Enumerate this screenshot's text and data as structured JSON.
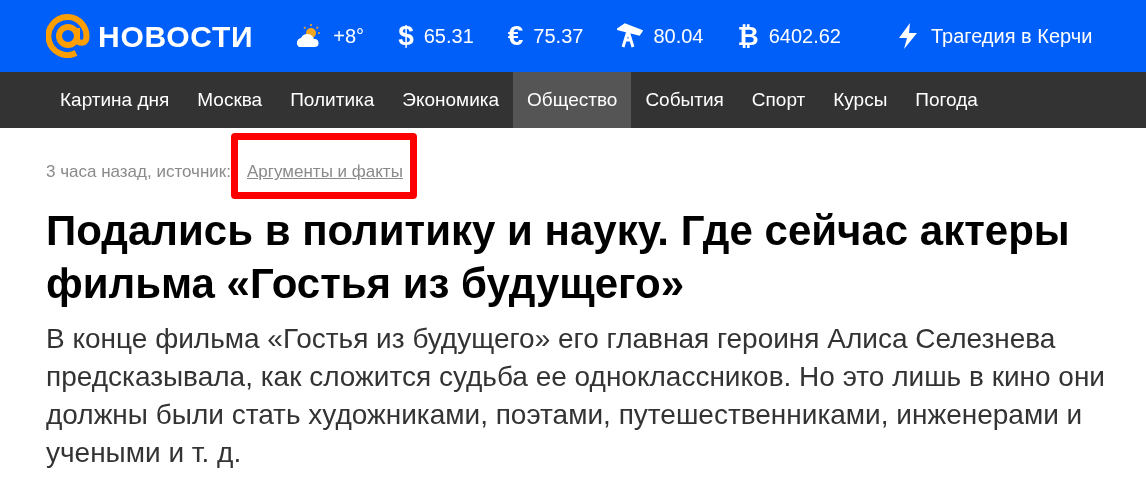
{
  "header": {
    "logo": "НОВОСТИ",
    "tickers": [
      {
        "kind": "weather",
        "value": "+8°"
      },
      {
        "kind": "dollar",
        "symbol": "$",
        "value": "65.31"
      },
      {
        "kind": "euro",
        "symbol": "€",
        "value": "75.37"
      },
      {
        "kind": "oil",
        "value": "80.04"
      },
      {
        "kind": "bitcoin",
        "symbol": "₿",
        "value": "6402.62"
      }
    ],
    "breaking": "Трагедия в Керчи"
  },
  "nav": [
    {
      "label": "Картина дня",
      "selected": false
    },
    {
      "label": "Москва",
      "selected": false
    },
    {
      "label": "Политика",
      "selected": false
    },
    {
      "label": "Экономика",
      "selected": false
    },
    {
      "label": "Общество",
      "selected": true
    },
    {
      "label": "События",
      "selected": false
    },
    {
      "label": "Спорт",
      "selected": false
    },
    {
      "label": "Курсы",
      "selected": false
    },
    {
      "label": "Погода",
      "selected": false
    }
  ],
  "article": {
    "meta": "3 часа назад, источник:",
    "source": "Аргументы и факты",
    "highlight": true,
    "title": "Подались в политику и науку. Где сейчас актеры фильма «Гостья из будущего»",
    "lead": "В конце фильма «Гостья из будущего» его главная героиня Алиса Селезнева предсказывала, как сложится судьба ее одноклассников. Но это лишь в кино они должны были стать художниками, поэтами, путешественниками, инженерами и учеными и т. д."
  }
}
